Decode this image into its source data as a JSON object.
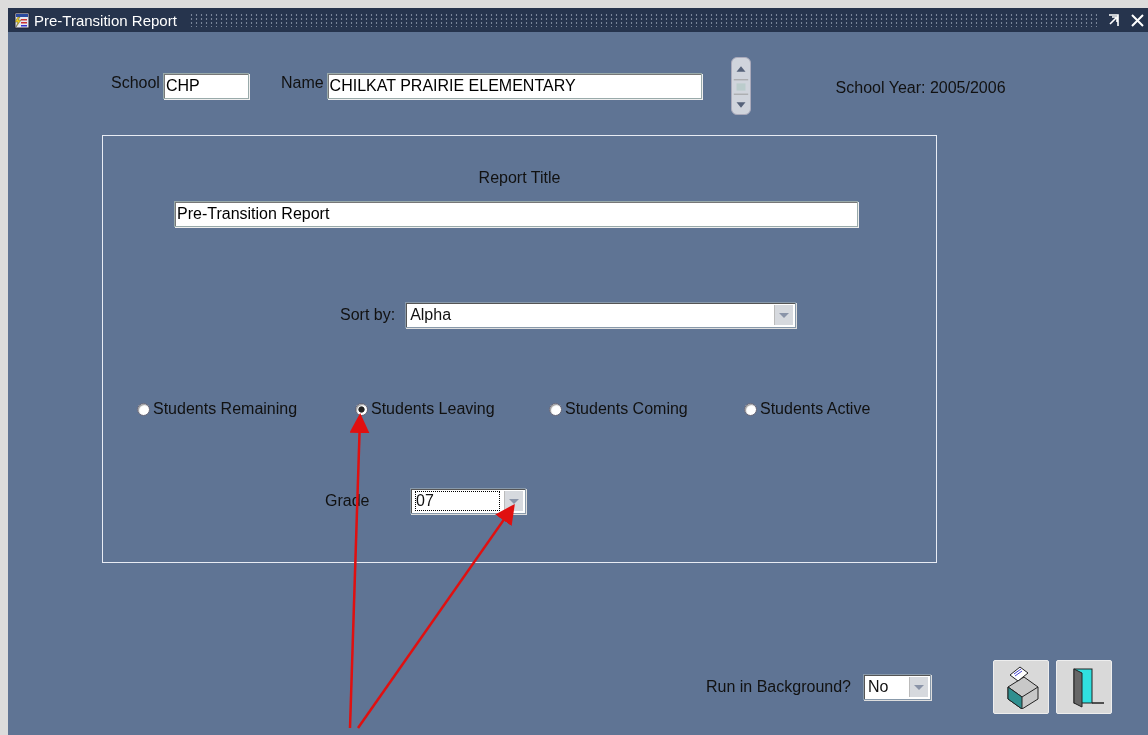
{
  "window": {
    "title": "Pre-Transition Report"
  },
  "header": {
    "school_label": "School",
    "school_value": "CHP",
    "name_label": "Name",
    "name_value": "CHILKAT PRAIRIE ELEMENTARY",
    "school_year": "School Year: 2005/2006"
  },
  "report": {
    "title_label": "Report Title",
    "title_value": "Pre-Transition Report",
    "sort_label": "Sort by:",
    "sort_value": "Alpha",
    "options": [
      {
        "label": "Students Remaining",
        "selected": false
      },
      {
        "label": "Students Leaving",
        "selected": true
      },
      {
        "label": "Students Coming",
        "selected": false
      },
      {
        "label": "Students Active",
        "selected": false
      }
    ],
    "grade_label": "Grade",
    "grade_value": "07"
  },
  "footer": {
    "background_label": "Run in Background?",
    "background_value": "No"
  }
}
